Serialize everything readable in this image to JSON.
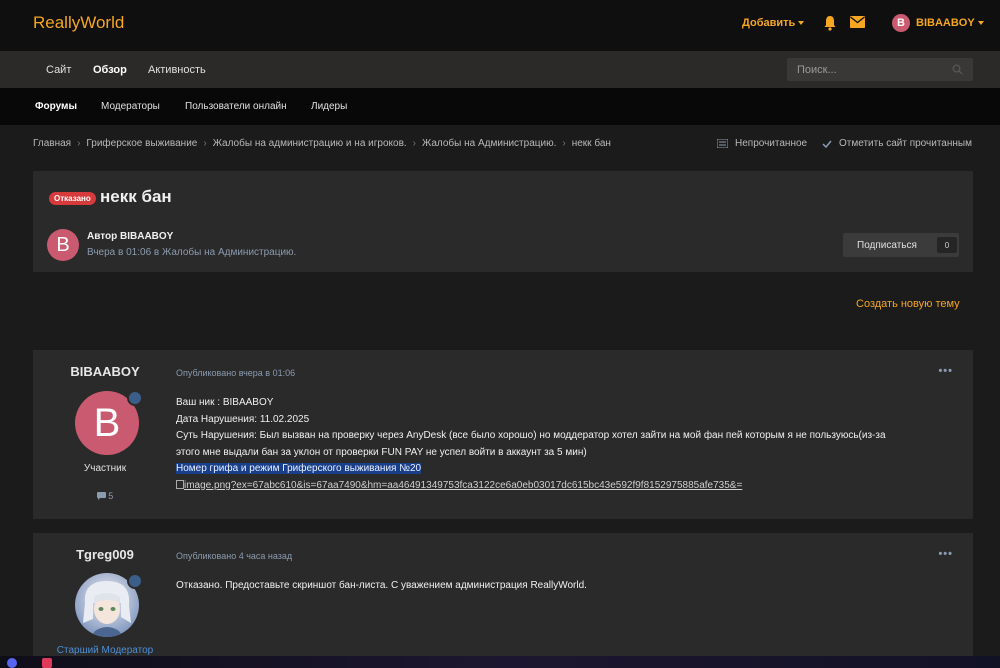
{
  "header": {
    "logo": "ReallyWorld",
    "add_label": "Добавить",
    "username": "BIBAABOY",
    "avatar_letter": "B"
  },
  "nav_primary": {
    "items": [
      "Сайт",
      "Обзор",
      "Активность"
    ],
    "active": "Обзор",
    "search_placeholder": "Поиск..."
  },
  "nav_secondary": {
    "items": [
      "Форумы",
      "Модераторы",
      "Пользователи онлайн",
      "Лидеры"
    ],
    "active": "Форумы"
  },
  "breadcrumb": {
    "items": [
      "Главная",
      "Гриферское выживание",
      "Жалобы на администрацию и на игроков.",
      "Жалобы на Администрацию.",
      "некк бан"
    ],
    "unread_label": "Непрочитанное",
    "mark_read_label": "Отметить сайт прочитанным"
  },
  "topic": {
    "status_badge": "Отказано",
    "title": "некк бан",
    "author_avatar_letter": "B",
    "author_line": "Автор BIBAABOY",
    "meta": "Вчера в 01:06 в Жалобы на Администрацию.",
    "follow_label": "Подписаться",
    "follow_count": "0"
  },
  "new_topic_label": "Создать новую тему",
  "posts": [
    {
      "author": "BIBAABOY",
      "avatar_letter": "B",
      "role": "Участник",
      "post_count": "5",
      "date": "Опубликовано вчера в 01:06",
      "lines": [
        "Ваш ник : BIBAABOY",
        "Дата Нарушения: 11.02.2025",
        "Суть Нарушения: Был вызван на проверку через AnyDesk (все было хорошо) но моддератор хотел  зайти на мой фан пей которым я не пользуюсь(из-за",
        "этого  мне  выдали бан за уклон от проверки FUN PAY не успел войти в аккаунт  за 5 мин)"
      ],
      "highlight_line": "Номер грифа и режим Гриферского выживания №20",
      "image_link": "image.png?ex=67abc610&is=67aa7490&hm=aa46491349753fca3122ce6a0eb03017dc615bc43e592f9f8152975885afe735&="
    },
    {
      "author": "Tgreg009",
      "role": "Старший Модератор",
      "date": "Опубликовано 4 часа назад",
      "text": "Отказано. Предоставьте скриншот бан-листа. С уважением администрация ReallyWorld."
    }
  ],
  "colors": {
    "accent": "#f5a623",
    "badge_denied": "#d63a3a",
    "avatar_pink": "#c95a6f",
    "highlight": "#1a3f8a"
  }
}
